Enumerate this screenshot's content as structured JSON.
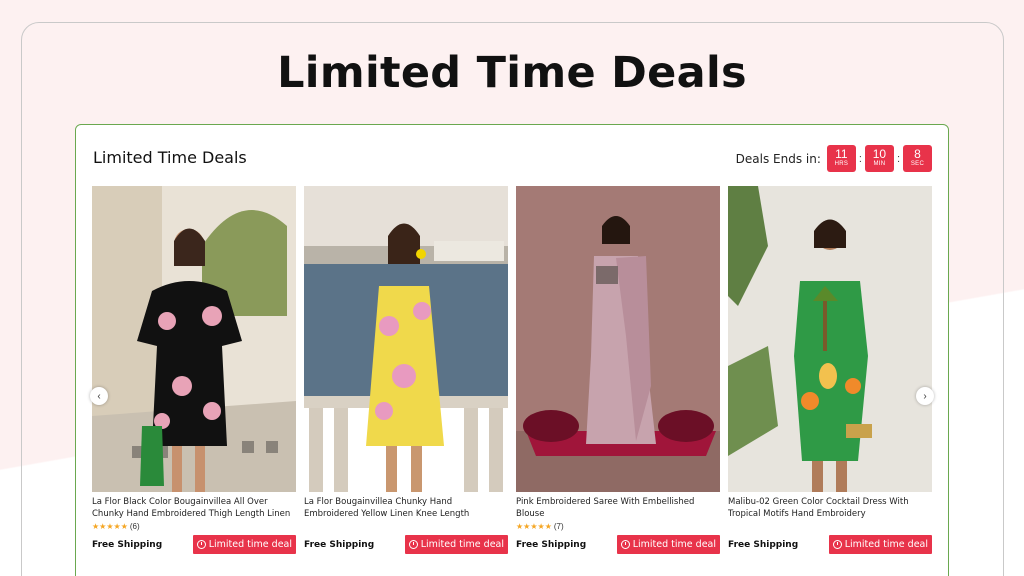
{
  "hero": {
    "title": "Limited Time Deals"
  },
  "widget": {
    "title": "Limited Time Deals",
    "timer": {
      "label": "Deals Ends in:",
      "hours": "11",
      "hours_unit": "HRS",
      "minutes": "10",
      "minutes_unit": "MIN",
      "seconds": "8",
      "seconds_unit": "SEC",
      "separator": ":"
    }
  },
  "products": [
    {
      "name": "La Flor Black Color Bougainvillea All Over Chunky Hand Embroidered Thigh Length Linen Fabric Dress",
      "stars": "★★★★★",
      "rating_count": "(6)",
      "shipping": "Free Shipping",
      "deal_label": "Limited time deal"
    },
    {
      "name": "La Flor Bougainvillea Chunky Hand Embroidered Yellow Linen Knee Length Sleeveless Shift Dress",
      "stars": "",
      "rating_count": "",
      "shipping": "Free Shipping",
      "deal_label": "Limited time deal"
    },
    {
      "name": "Pink Embroidered Saree With Embellished Blouse",
      "stars": "★★★★★",
      "rating_count": "(7)",
      "shipping": "Free Shipping",
      "deal_label": "Limited time deal"
    },
    {
      "name": "Malibu-02 Green Color Cocktail Dress With Tropical Motifs Hand Embroidery",
      "stars": "",
      "rating_count": "",
      "shipping": "Free Shipping",
      "deal_label": "Limited time deal"
    }
  ],
  "nav": {
    "prev_icon": "‹",
    "next_icon": "›"
  },
  "colors": {
    "accent": "#e8334a",
    "border_green": "#6aa84f",
    "star": "#f5a623"
  }
}
